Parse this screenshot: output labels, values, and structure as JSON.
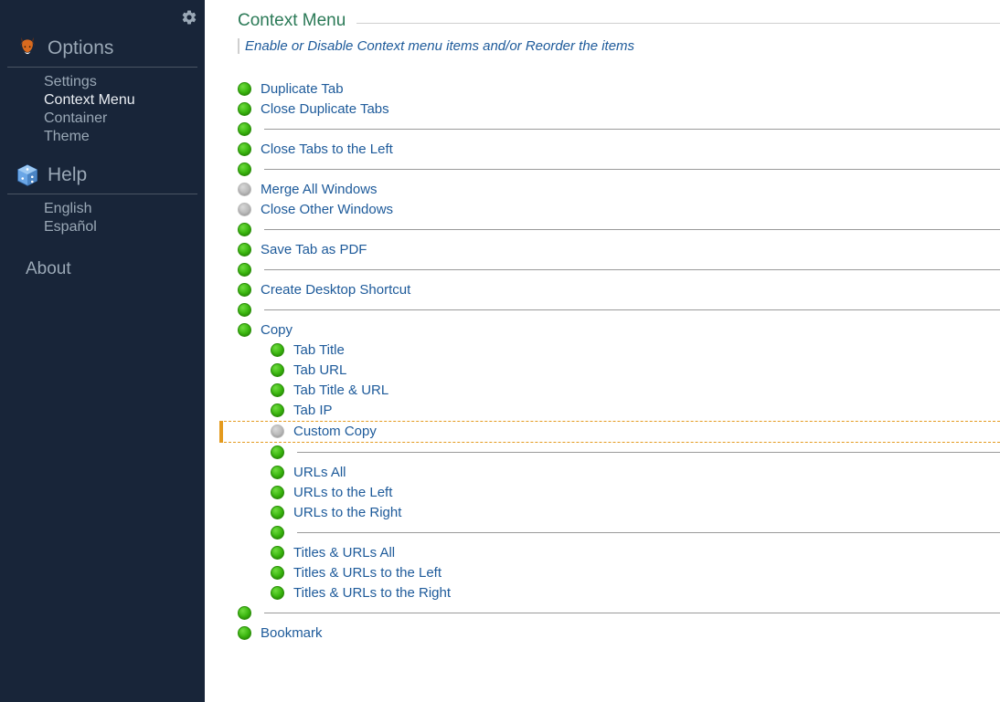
{
  "sidebar": {
    "options": {
      "header": "Options",
      "items": [
        {
          "label": "Settings",
          "active": false
        },
        {
          "label": "Context Menu",
          "active": true
        },
        {
          "label": "Container",
          "active": false
        },
        {
          "label": "Theme",
          "active": false
        }
      ]
    },
    "help": {
      "header": "Help",
      "items": [
        {
          "label": "English"
        },
        {
          "label": "Español"
        }
      ]
    },
    "about": "About"
  },
  "panel": {
    "title": "Context Menu",
    "subtitle": "Enable or Disable Context menu items and/or Reorder the items"
  },
  "menu": [
    {
      "kind": "item",
      "label": "Duplicate Tab",
      "state": "green"
    },
    {
      "kind": "item",
      "label": "Close Duplicate Tabs",
      "state": "green"
    },
    {
      "kind": "sep",
      "state": "green"
    },
    {
      "kind": "item",
      "label": "Close Tabs to the Left",
      "state": "green"
    },
    {
      "kind": "sep",
      "state": "green"
    },
    {
      "kind": "item",
      "label": "Merge All Windows",
      "state": "grey"
    },
    {
      "kind": "item",
      "label": "Close Other Windows",
      "state": "grey"
    },
    {
      "kind": "sep",
      "state": "green"
    },
    {
      "kind": "item",
      "label": "Save Tab as PDF",
      "state": "green"
    },
    {
      "kind": "sep",
      "state": "green"
    },
    {
      "kind": "item",
      "label": "Create Desktop Shortcut",
      "state": "green"
    },
    {
      "kind": "sep",
      "state": "green"
    },
    {
      "kind": "item",
      "label": "Copy",
      "state": "green"
    },
    {
      "kind": "sub",
      "label": "Tab Title",
      "state": "green"
    },
    {
      "kind": "sub",
      "label": "Tab URL",
      "state": "green"
    },
    {
      "kind": "sub",
      "label": "Tab Title & URL",
      "state": "green"
    },
    {
      "kind": "sub",
      "label": "Tab IP",
      "state": "green"
    },
    {
      "kind": "sub-drag",
      "label": "Custom Copy",
      "state": "grey"
    },
    {
      "kind": "sub-sep",
      "state": "green"
    },
    {
      "kind": "sub",
      "label": "URLs All",
      "state": "green"
    },
    {
      "kind": "sub",
      "label": "URLs to the Left",
      "state": "green"
    },
    {
      "kind": "sub",
      "label": "URLs to the Right",
      "state": "green"
    },
    {
      "kind": "sub-sep",
      "state": "green"
    },
    {
      "kind": "sub",
      "label": "Titles & URLs All",
      "state": "green"
    },
    {
      "kind": "sub",
      "label": "Titles & URLs to the Left",
      "state": "green"
    },
    {
      "kind": "sub",
      "label": "Titles & URLs to the Right",
      "state": "green"
    },
    {
      "kind": "sep",
      "state": "green"
    },
    {
      "kind": "item",
      "label": "Bookmark",
      "state": "green"
    }
  ]
}
